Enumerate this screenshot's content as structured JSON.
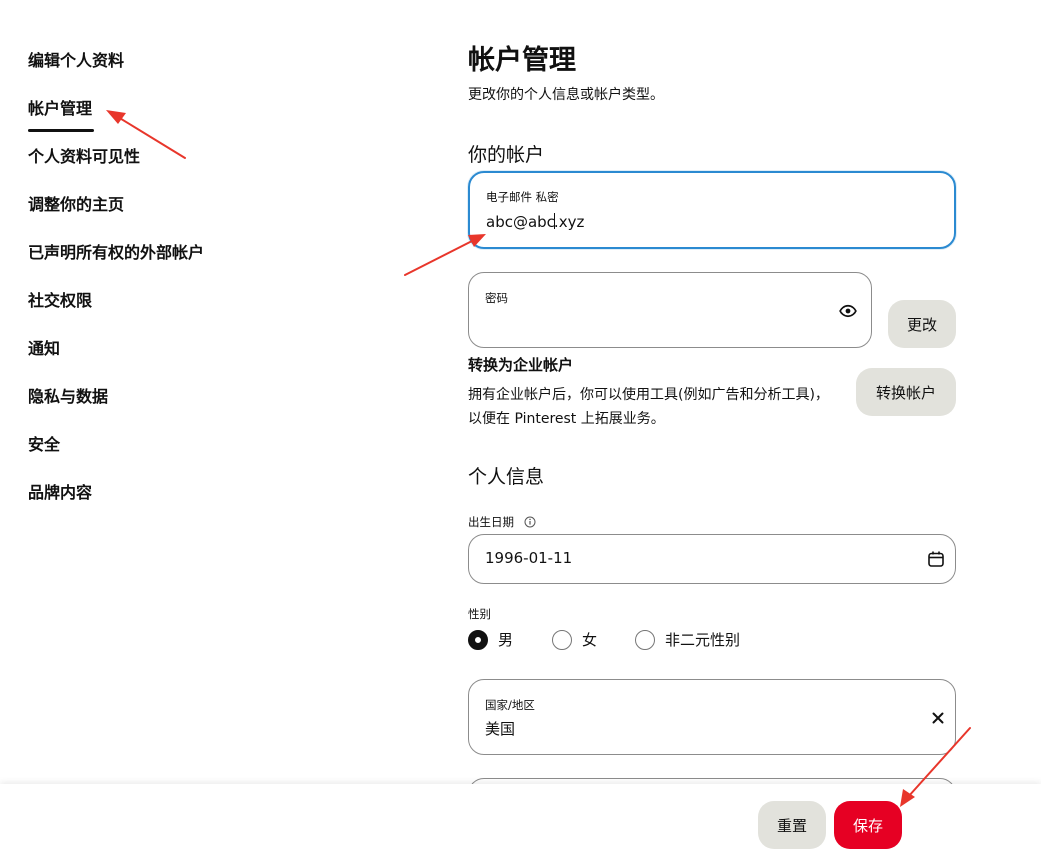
{
  "sidebar": {
    "items": [
      {
        "label": "编辑个人资料"
      },
      {
        "label": "帐户管理"
      },
      {
        "label": "个人资料可见性"
      },
      {
        "label": "调整你的主页"
      },
      {
        "label": "已声明所有权的外部帐户"
      },
      {
        "label": "社交权限"
      },
      {
        "label": "通知"
      },
      {
        "label": "隐私与数据"
      },
      {
        "label": "安全"
      },
      {
        "label": "品牌内容"
      }
    ],
    "active_index": 1
  },
  "main": {
    "title": "帐户管理",
    "subtitle": "更改你的个人信息或帐户类型。",
    "your_account": {
      "heading": "你的帐户",
      "email": {
        "label": "电子邮件 私密",
        "value_before_caret": "abc@abc",
        "value_after_caret": ".xyz"
      },
      "password": {
        "label": "密码",
        "value": "",
        "show_icon": "eye-icon",
        "change_label": "更改"
      },
      "convert": {
        "title": "转换为企业帐户",
        "description": "拥有企业帐户后，你可以使用工具(例如广告和分析工具)，以便在 Pinterest 上拓展业务。",
        "button_label": "转换帐户"
      }
    },
    "personal_info": {
      "heading": "个人信息",
      "birthdate": {
        "label": "出生日期",
        "info_icon": "info-icon",
        "value": "1996-01-11",
        "calendar_icon": "calendar-icon"
      },
      "gender": {
        "label": "性别",
        "options": [
          {
            "label": "男"
          },
          {
            "label": "女"
          },
          {
            "label": "非二元性别"
          }
        ],
        "selected": "男"
      },
      "country": {
        "label": "国家/地区",
        "value": "美国",
        "clear_icon": "close-icon"
      }
    }
  },
  "footer": {
    "reset_label": "重置",
    "save_label": "保存"
  },
  "colors": {
    "accent": "#e60023",
    "focus": "#2b8ad1",
    "pill_bg": "#e2e2dc",
    "annotation": "#e8362b"
  }
}
